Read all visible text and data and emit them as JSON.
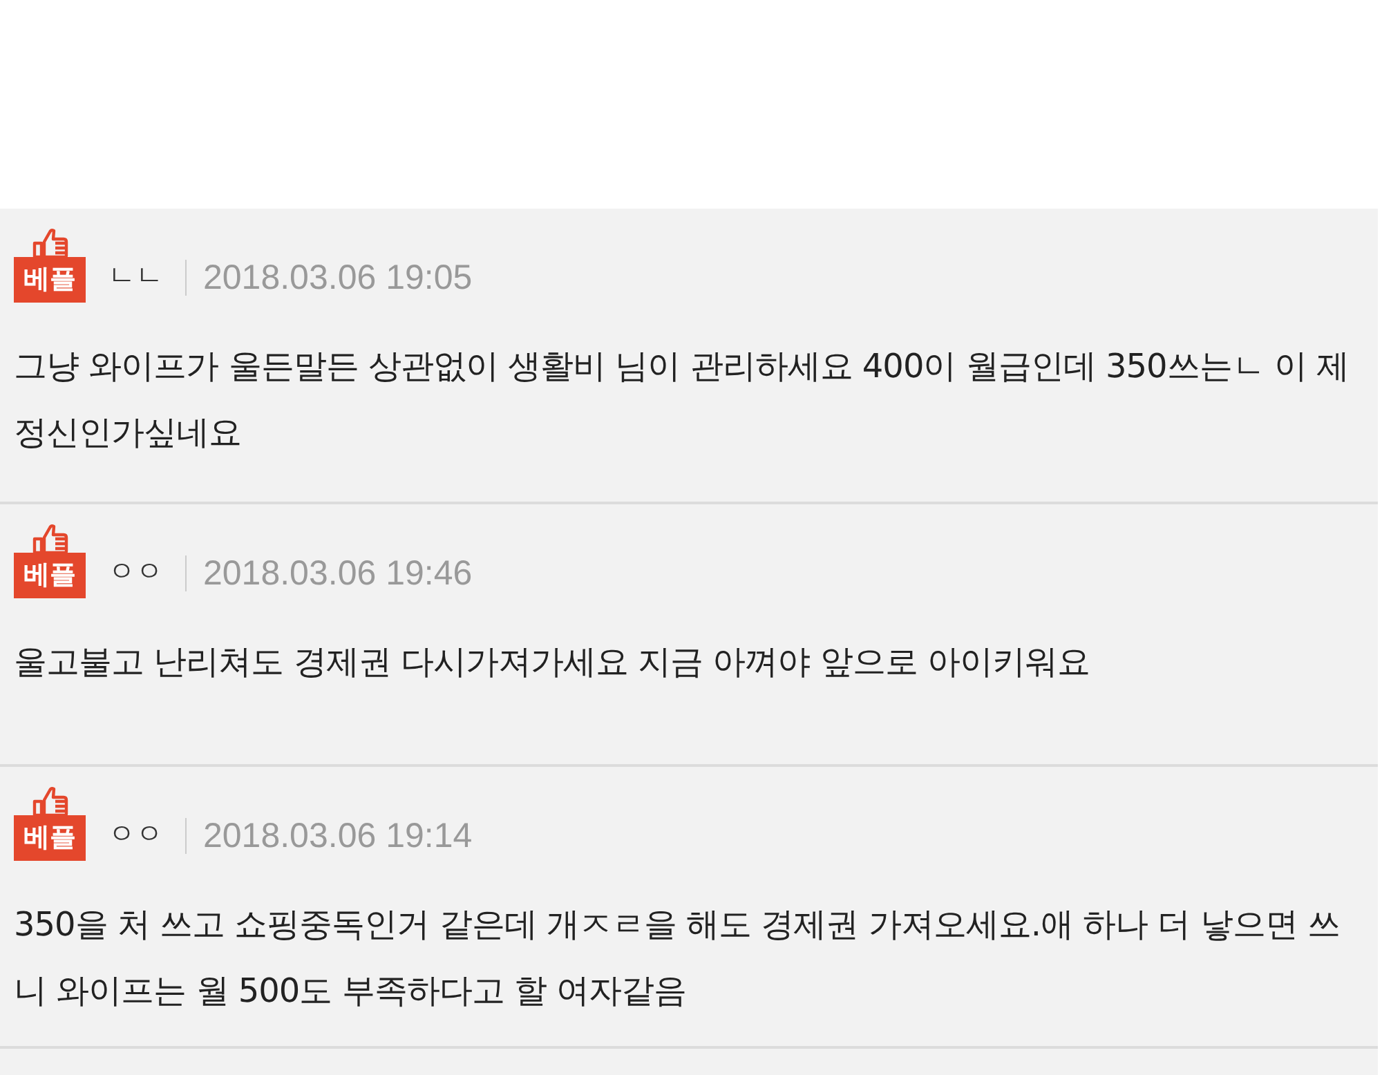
{
  "comments": [
    {
      "badge": "베플",
      "author": "ㄴㄴ",
      "date": "2018.03.06 19:05",
      "text": "그냥 와이프가 울든말든 상관없이 생활비 님이 관리하세요 400이 월급인데 350쓰는ㄴ 이 제정신인가싶네요"
    },
    {
      "badge": "베플",
      "author": "ㅇㅇ",
      "date": "2018.03.06 19:46",
      "text": "울고불고 난리쳐도 경제권 다시가져가세요 지금 아껴야 앞으로 아이키워요"
    },
    {
      "badge": "베플",
      "author": "ㅇㅇ",
      "date": "2018.03.06 19:14",
      "text": "350을 처 쓰고 쇼핑중독인거 같은데 개ㅈㄹ을 해도 경제권 가져오세요.애 하나 더 낳으면 쓰니 와이프는 월 500도 부족하다고 할 여자같음"
    }
  ]
}
